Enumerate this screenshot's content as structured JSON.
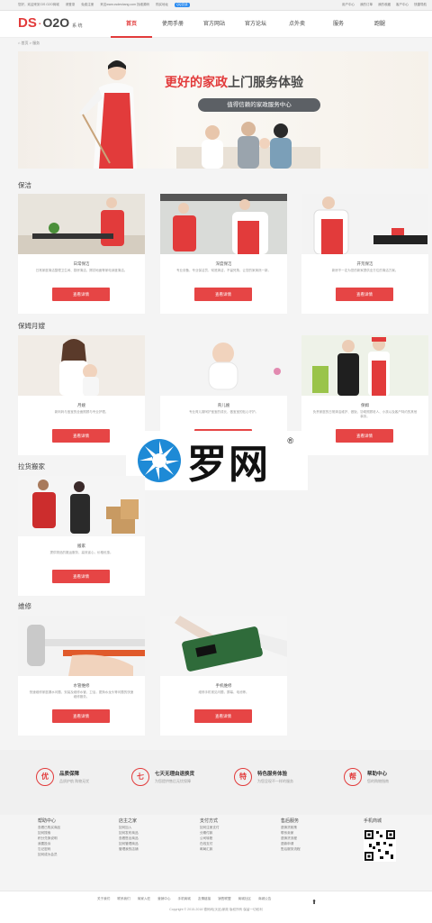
{
  "topbar": {
    "left": [
      "您好，欢迎来到 DS O2O商城",
      "请登录",
      "免费注册",
      "来这www.csdeshang.com 找维源码",
      "购买地址"
    ],
    "qq": "QQ交谈",
    "right": [
      "用户中心",
      "我的订单",
      "我的收藏",
      "客户中心",
      "快捷导航"
    ]
  },
  "header": {
    "logo_ds": "DS",
    "logo_dot": "·",
    "logo_o2o": "O2O",
    "logo_sys": "系 统",
    "nav": [
      "首页",
      "使用手册",
      "官方网站",
      "官方论坛",
      "点外卖",
      "服务",
      "跑腿"
    ]
  },
  "breadcrumb": "首页 > 服务",
  "banner": {
    "headline_red": "更好的家政",
    "headline_dark": "上门服务体验",
    "pill": "值得信赖的家政服务中心"
  },
  "sections": [
    {
      "title": "保洁",
      "cards": [
        {
          "name": "日常保洁",
          "desc": "日常家庭清洁整理卫生间、厨房清洁、擦拭地面等家电深度清洁。",
          "btn": "查看详情"
        },
        {
          "name": "深度保洁",
          "desc": "专业设备，专业保洁员，彻底清洁，不留死角，让您的家焕然一新。",
          "btn": "查看详情"
        },
        {
          "name": "开荒保洁",
          "desc": "新房不一定为您的新家提供全方位的清洁方案。",
          "btn": "查看详情"
        }
      ]
    },
    {
      "title": "保姆月嫂",
      "cards": [
        {
          "name": "月嫂",
          "desc": "新妈妈与宝宝的全面照顾与专业护理。",
          "btn": "查看详情"
        },
        {
          "name": "育儿嫂",
          "desc": "专业育儿嫂呵护宝宝的成长，做宝宝的贴心守护。",
          "btn": "查看详情"
        },
        {
          "name": "保姆",
          "desc": "负责家庭的日常清洁维护、做饭、协助照顾老人、小孩以及客户特约的其他事务。",
          "btn": "查看详情"
        }
      ]
    },
    {
      "title": "拉货搬家",
      "cards": [
        {
          "name": "搬家",
          "desc": "提供物品的搬运服务，高效省心，价格优惠。",
          "btn": "查看详情"
        }
      ]
    },
    {
      "title": "维修",
      "cards": [
        {
          "name": "水管维修",
          "desc": "快速维修家庭漏水问题，安装及维修水管、卫浴，更换水龙头等问题的快速维修服务。",
          "btn": "查看详情"
        },
        {
          "name": "手机维修",
          "desc": "维修手机常见问题，屏幕、电池等。",
          "btn": "查看详情"
        }
      ]
    }
  ],
  "watermark": {
    "text": "罗网",
    "reg": "®"
  },
  "services": [
    {
      "icon": "优",
      "title": "品质保障",
      "sub": "品质护航 购物无忧"
    },
    {
      "icon": "七",
      "title": "七天无理由退换货",
      "sub": "为您提供售后无忧保障"
    },
    {
      "icon": "特",
      "title": "特色服务体验",
      "sub": "为您呈现不一样的服务"
    },
    {
      "icon": "帮",
      "title": "帮助中心",
      "sub": "您的购物指南"
    }
  ],
  "footer_cols": [
    {
      "title": "帮助中心",
      "items": [
        "查看已购买商品",
        "如何搜索",
        "积分兑换说明",
        "我要投诉",
        "忘记密码",
        "如何成为会员"
      ]
    },
    {
      "title": "店主之家",
      "items": [
        "如何加入",
        "如何发布商品",
        "查看售出商品",
        "如何管理商品",
        "管理我的店铺"
      ]
    },
    {
      "title": "支付方式",
      "items": [
        "如何注册支付",
        "分期付款",
        "公司转账",
        "在线支付",
        "邮局汇款"
      ]
    },
    {
      "title": "售后服务",
      "items": [
        "退换货政策",
        "联系卖家",
        "退换货流程",
        "退款申请",
        "售后服务流程"
      ]
    }
  ],
  "mobile": "手机商城",
  "bottom_links": [
    "关于我们",
    "联系我们",
    "商家入驻",
    "营销中心",
    "手机商城",
    "友情链接",
    "销售联盟",
    "商城社区",
    "商城公告"
  ],
  "copyright": "Copyright © 2015-2018 德码网(沃品)家政 版权所有 保留一切权利"
}
